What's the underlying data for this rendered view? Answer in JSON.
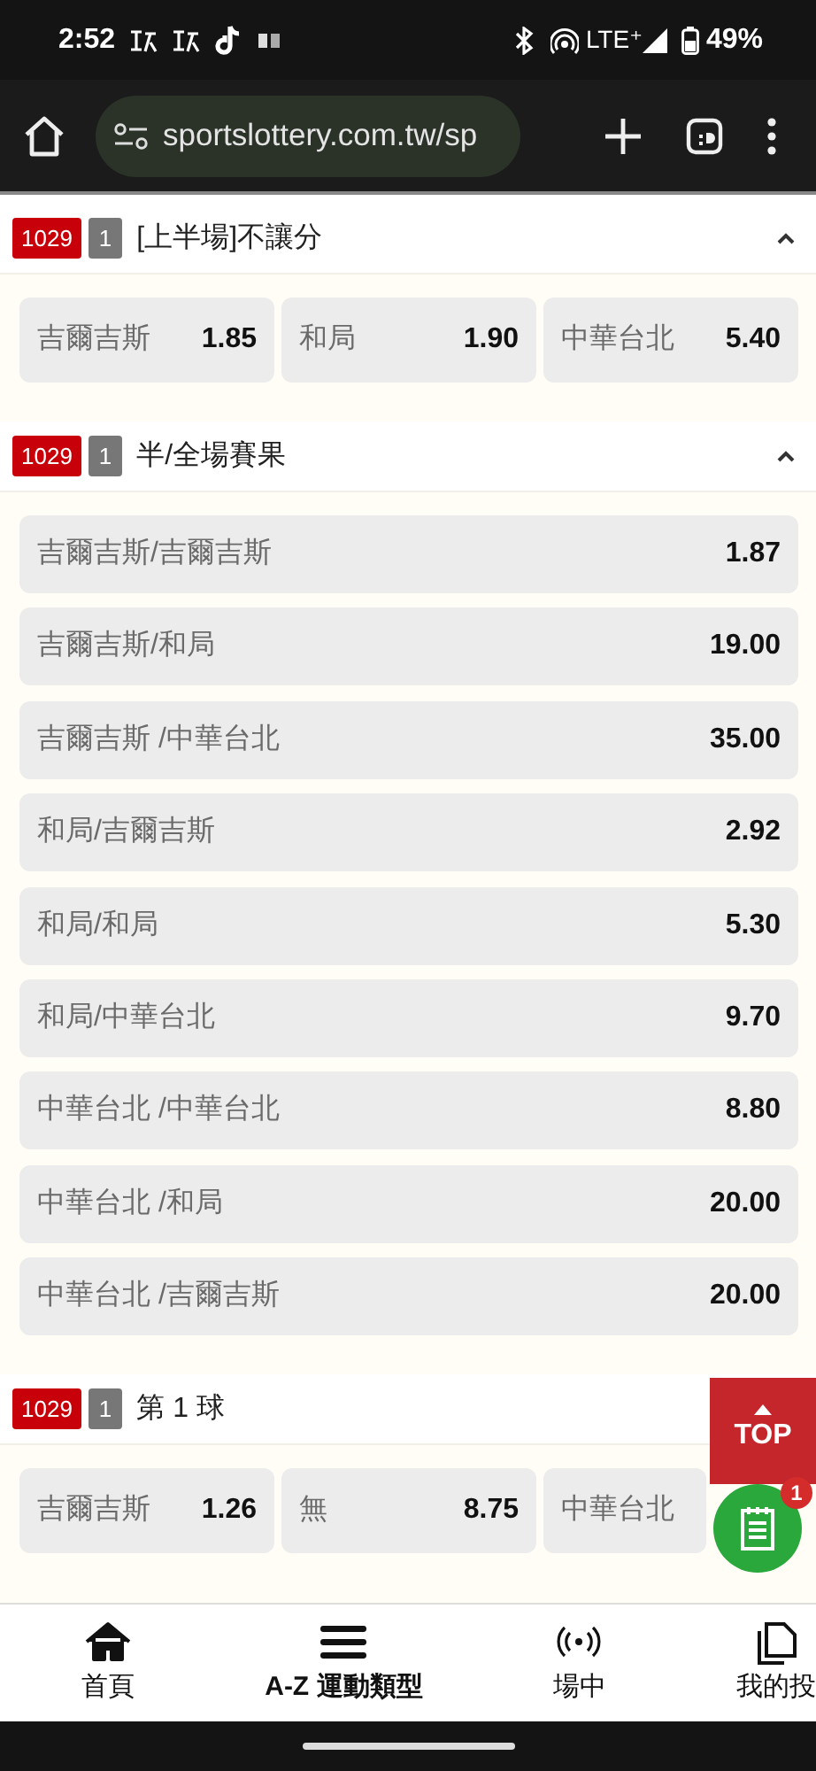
{
  "status_bar": {
    "time": "2:52",
    "network": "LTE⁺",
    "battery": "49%"
  },
  "browser": {
    "url": "sportslottery.com.tw/sp"
  },
  "sections": [
    {
      "event_code": "1029",
      "period": "1",
      "title": "[上半場]不讓分",
      "expanded": true,
      "kind": "grid",
      "outcomes": [
        {
          "label": "吉爾吉斯",
          "price": "1.85"
        },
        {
          "label": "和局",
          "price": "1.90"
        },
        {
          "label": "中華台北",
          "price": "5.40"
        }
      ]
    },
    {
      "event_code": "1029",
      "period": "1",
      "title": "半/全場賽果",
      "expanded": true,
      "kind": "list",
      "outcomes": [
        {
          "label": "吉爾吉斯/吉爾吉斯",
          "price": "1.87"
        },
        {
          "label": "吉爾吉斯/和局",
          "price": "19.00"
        },
        {
          "label": "吉爾吉斯 /中華台北",
          "price": "35.00"
        },
        {
          "label": "和局/吉爾吉斯",
          "price": "2.92"
        },
        {
          "label": "和局/和局",
          "price": "5.30"
        },
        {
          "label": "和局/中華台北",
          "price": "9.70"
        },
        {
          "label": "中華台北 /中華台北",
          "price": "8.80"
        },
        {
          "label": "中華台北 /和局",
          "price": "20.00"
        },
        {
          "label": "中華台北 /吉爾吉斯",
          "price": "20.00"
        }
      ]
    },
    {
      "event_code": "1029",
      "period": "1",
      "title": "第 1 球",
      "kind": "grid",
      "outcomes": [
        {
          "label": "吉爾吉斯",
          "price": "1.26"
        },
        {
          "label": "無",
          "price": "8.75"
        },
        {
          "label": "中華台北"
        }
      ]
    }
  ],
  "top_button": {
    "label": "TOP"
  },
  "bet_slip": {
    "count": "1"
  },
  "bottom_nav": [
    {
      "label": "首頁"
    },
    {
      "label": "A-Z 運動類型"
    },
    {
      "label": "場中"
    },
    {
      "label": "我的投"
    }
  ]
}
